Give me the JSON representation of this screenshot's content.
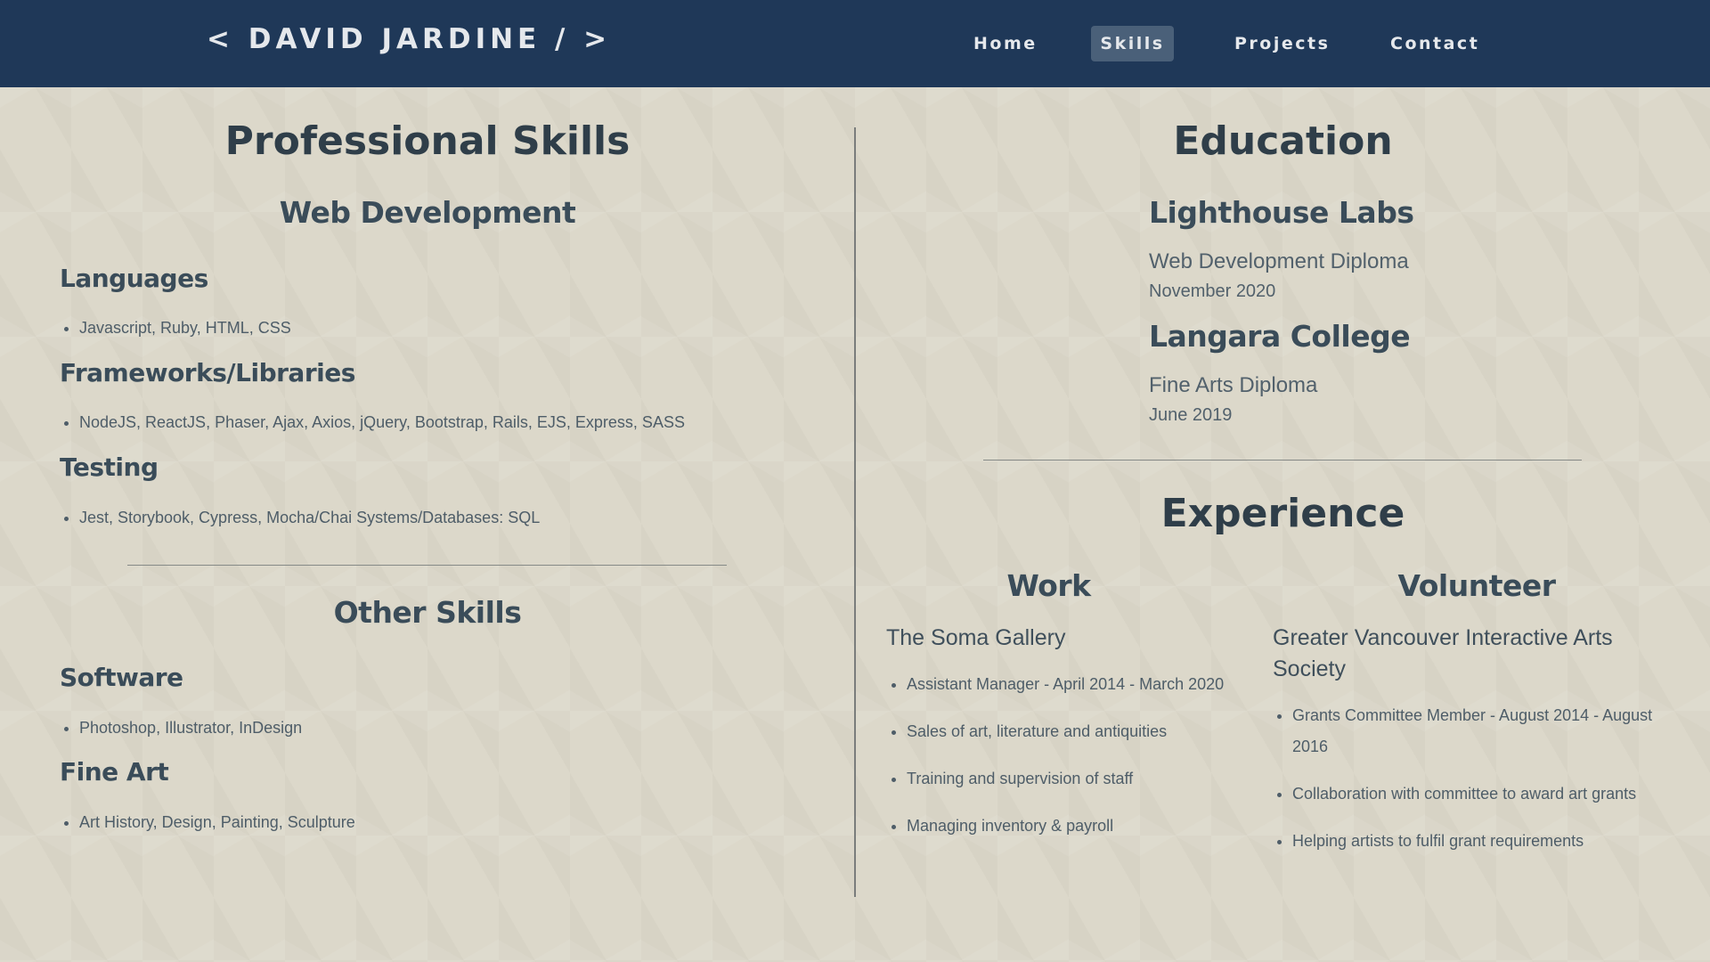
{
  "navbar": {
    "brand": "< DAVID JARDINE / >",
    "items": [
      {
        "label": "Home"
      },
      {
        "label": "Skills",
        "active": true
      },
      {
        "label": "Projects"
      },
      {
        "label": "Contact"
      }
    ],
    "bg_color": "#1f3858",
    "active_color": "#4a6079"
  },
  "skills": {
    "title": "Professional Skills",
    "web_dev": {
      "title": "Web Development",
      "groups": [
        {
          "heading": "Languages",
          "items": [
            "Javascript, Ruby, HTML, CSS"
          ]
        },
        {
          "heading": "Frameworks/Libraries",
          "items": [
            "NodeJS, ReactJS, Phaser, Ajax, Axios, jQuery, Bootstrap, Rails, EJS, Express, SASS"
          ]
        },
        {
          "heading": "Testing",
          "items": [
            "Jest, Storybook, Cypress, Mocha/Chai Systems/Databases: SQL"
          ]
        }
      ]
    },
    "other": {
      "title": "Other Skills",
      "groups": [
        {
          "heading": "Software",
          "items": [
            "Photoshop, Illustrator, InDesign"
          ]
        },
        {
          "heading": "Fine Art",
          "items": [
            "Art History, Design, Painting, Sculpture"
          ]
        }
      ]
    }
  },
  "education": {
    "title": "Education",
    "schools": [
      {
        "name": "Lighthouse Labs",
        "credential": "Web Development Diploma",
        "date": "November 2020"
      },
      {
        "name": "Langara College",
        "credential": "Fine Arts Diploma",
        "date": "June 2019"
      }
    ]
  },
  "experience": {
    "title": "Experience",
    "work": {
      "title": "Work",
      "org": "The Soma Gallery",
      "items": [
        "Assistant Manager - April 2014 - March 2020",
        "Sales of art, literature and antiquities",
        "Training and supervision of staff",
        "Managing inventory & payroll"
      ]
    },
    "volunteer": {
      "title": "Volunteer",
      "org": "Greater Vancouver Interactive Arts Society",
      "items": [
        "Grants Committee Member - August 2014 - August 2016",
        "Collaboration with committee to award art grants",
        "Helping artists to fulfil grant requirements"
      ]
    }
  }
}
